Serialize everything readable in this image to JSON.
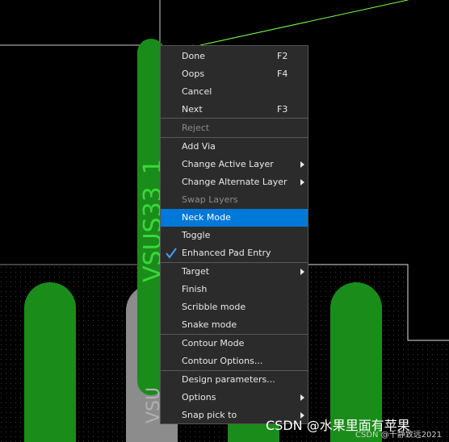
{
  "menu": {
    "items": [
      {
        "label": "Done",
        "shortcut": "F2"
      },
      {
        "label": "Oops",
        "shortcut": "F4"
      },
      {
        "label": "Cancel"
      },
      {
        "label": "Next",
        "shortcut": "F3"
      },
      {
        "label": "Reject",
        "disabled": true
      },
      {
        "label": "Add Via"
      },
      {
        "label": "Change Active Layer",
        "submenu": true
      },
      {
        "label": "Change Alternate Layer",
        "submenu": true
      },
      {
        "label": "Swap Layers",
        "disabled": true
      },
      {
        "label": "Neck Mode",
        "highlighted": true
      },
      {
        "label": "Toggle"
      },
      {
        "label": "Enhanced Pad Entry",
        "checked": true
      },
      {
        "label": "Target",
        "submenu": true
      },
      {
        "label": "Finish"
      },
      {
        "label": "Scribble mode"
      },
      {
        "label": "Snake mode"
      },
      {
        "label": "Contour Mode"
      },
      {
        "label": "Contour Options..."
      },
      {
        "label": "Design parameters..."
      },
      {
        "label": "Options",
        "submenu": true
      },
      {
        "label": "Snap pick to",
        "submenu": true
      }
    ]
  },
  "board": {
    "net_label": "VSUS33_1",
    "net_label_partial": "VSU",
    "trace_color": "#1a8c1a",
    "net_text_color": "#39d839",
    "pad_gray": "#8c8c8c",
    "ratsnest_color": "#7cff4a"
  },
  "watermark": {
    "main": "CSDN @水果里面有苹果",
    "sub": "CSDN @千静致远2021"
  }
}
